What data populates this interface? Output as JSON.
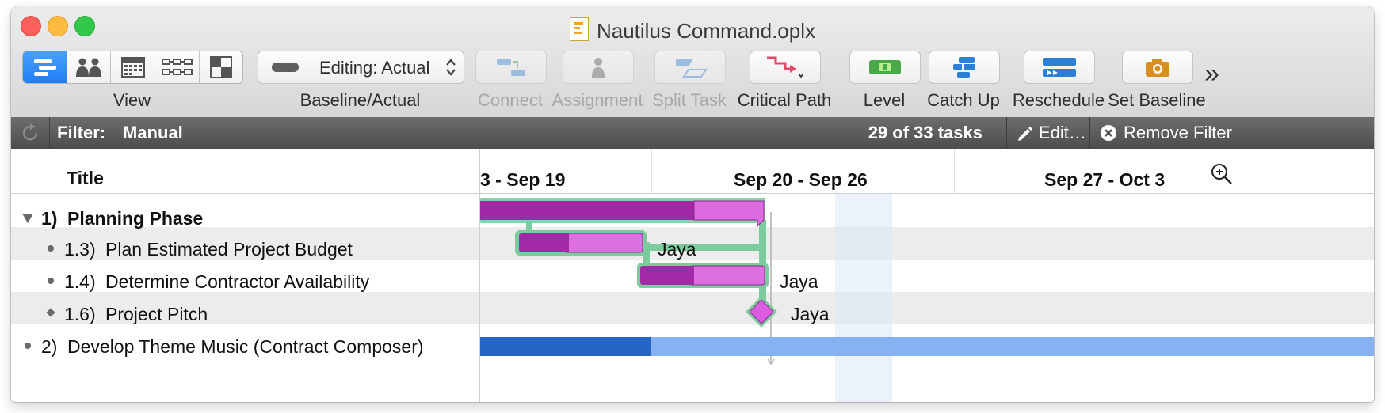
{
  "window": {
    "title": "Nautilus Command.oplx",
    "colors": {
      "close": "#fc605c",
      "minimize": "#fdbc40",
      "zoom": "#34c84a"
    }
  },
  "toolbar": {
    "view_label": "View",
    "baseline_label": "Baseline/Actual",
    "baseline_value": "Editing: Actual",
    "buttons": [
      {
        "label": "Connect",
        "enabled": false
      },
      {
        "label": "Assignment",
        "enabled": false
      },
      {
        "label": "Split Task",
        "enabled": false
      },
      {
        "label": "Critical Path",
        "enabled": true
      },
      {
        "label": "Level",
        "enabled": true
      },
      {
        "label": "Catch Up",
        "enabled": true
      },
      {
        "label": "Reschedule",
        "enabled": true
      },
      {
        "label": "Set Baseline",
        "enabled": true
      }
    ],
    "overflow": "»"
  },
  "filter": {
    "prefix": "Filter:",
    "name": "Manual",
    "count": "29 of 33 tasks",
    "edit": "Edit…",
    "remove": "Remove Filter"
  },
  "outline": {
    "header": "Title",
    "rows": [
      {
        "num": "1)",
        "title": "Planning Phase",
        "marker": "disclosure-open",
        "bold": true
      },
      {
        "num": "1.3)",
        "title": "Plan Estimated Project Budget",
        "marker": "bullet",
        "bold": false
      },
      {
        "num": "1.4)",
        "title": "Determine Contractor Availability",
        "marker": "bullet",
        "bold": false
      },
      {
        "num": "1.6)",
        "title": "Project Pitch",
        "marker": "milestone",
        "bold": false
      },
      {
        "num": "2)",
        "title": "Develop Theme Music (Contract Composer)",
        "marker": "bullet",
        "bold": false
      }
    ]
  },
  "gantt": {
    "weeks": [
      "3 - Sep 19",
      "Sep 20 - Sep 26",
      "Sep 27 - Oct 3"
    ],
    "resources": [
      "Jaya",
      "Jaya",
      "Jaya"
    ],
    "colors": {
      "group_done": "#a02aa6",
      "group_remaining": "#dd6ce0",
      "task_done": "#a12aa7",
      "task_remaining": "#de6fe1",
      "critical_path": "#7dcb9d",
      "blue_done": "#2566c4",
      "blue_remaining": "#86b2f4"
    }
  }
}
